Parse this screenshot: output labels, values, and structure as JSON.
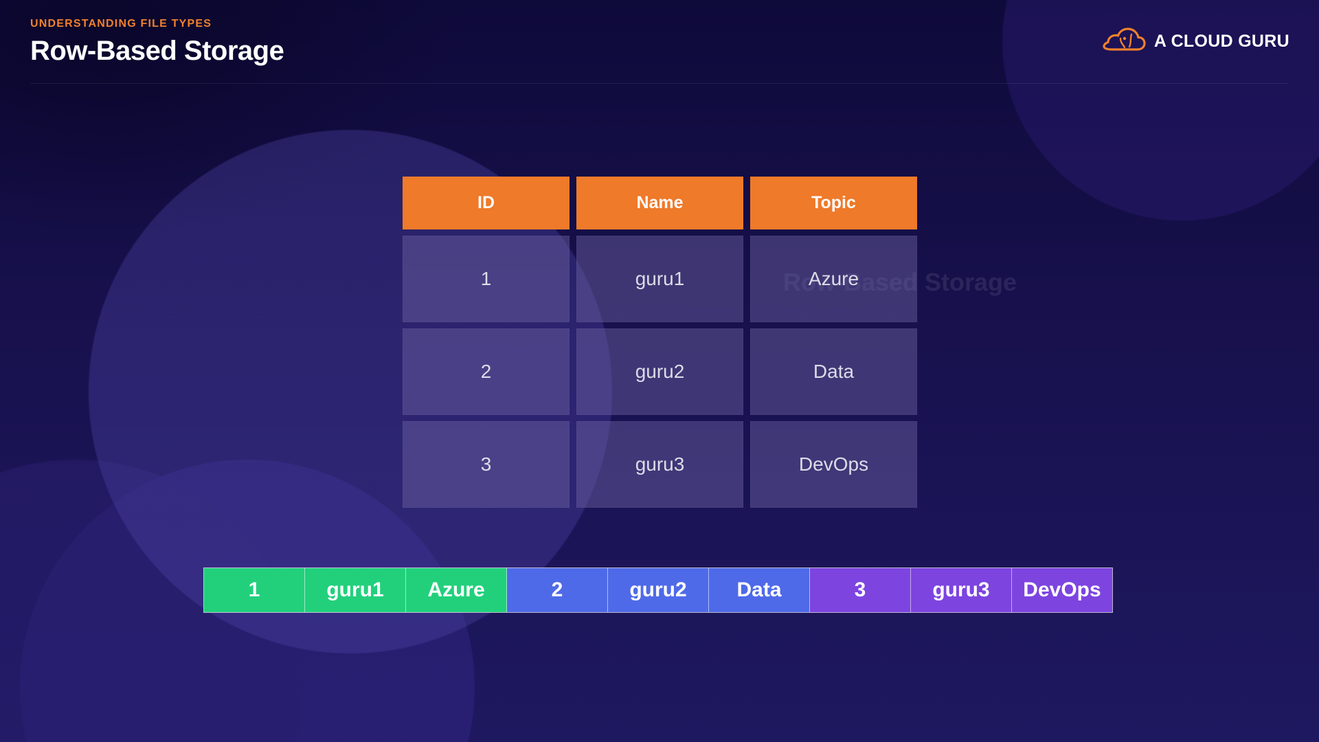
{
  "header": {
    "eyebrow": "UNDERSTANDING FILE TYPES",
    "title": "Row-Based Storage"
  },
  "logo": {
    "icon": "cloud-icon",
    "text": "A CLOUD GURU",
    "color": "#f0812d"
  },
  "background_text": {
    "title": "Row-Based Storage",
    "subtitle": ""
  },
  "table": {
    "headers": [
      "ID",
      "Name",
      "Topic"
    ],
    "rows": [
      [
        "1",
        "guru1",
        "Azure"
      ],
      [
        "2",
        "guru2",
        "Data"
      ],
      [
        "3",
        "guru3",
        "DevOps"
      ]
    ],
    "header_color": "#ee7a2a"
  },
  "storage_strip": {
    "cells": [
      {
        "text": "1",
        "color": "#22d07c"
      },
      {
        "text": "guru1",
        "color": "#22d07c"
      },
      {
        "text": "Azure",
        "color": "#22d07c"
      },
      {
        "text": "2",
        "color": "#4f6ae8"
      },
      {
        "text": "guru2",
        "color": "#4f6ae8"
      },
      {
        "text": "Data",
        "color": "#4f6ae8"
      },
      {
        "text": "3",
        "color": "#7d44e0"
      },
      {
        "text": "guru3",
        "color": "#7d44e0"
      },
      {
        "text": "DevOps",
        "color": "#7d44e0"
      }
    ]
  }
}
